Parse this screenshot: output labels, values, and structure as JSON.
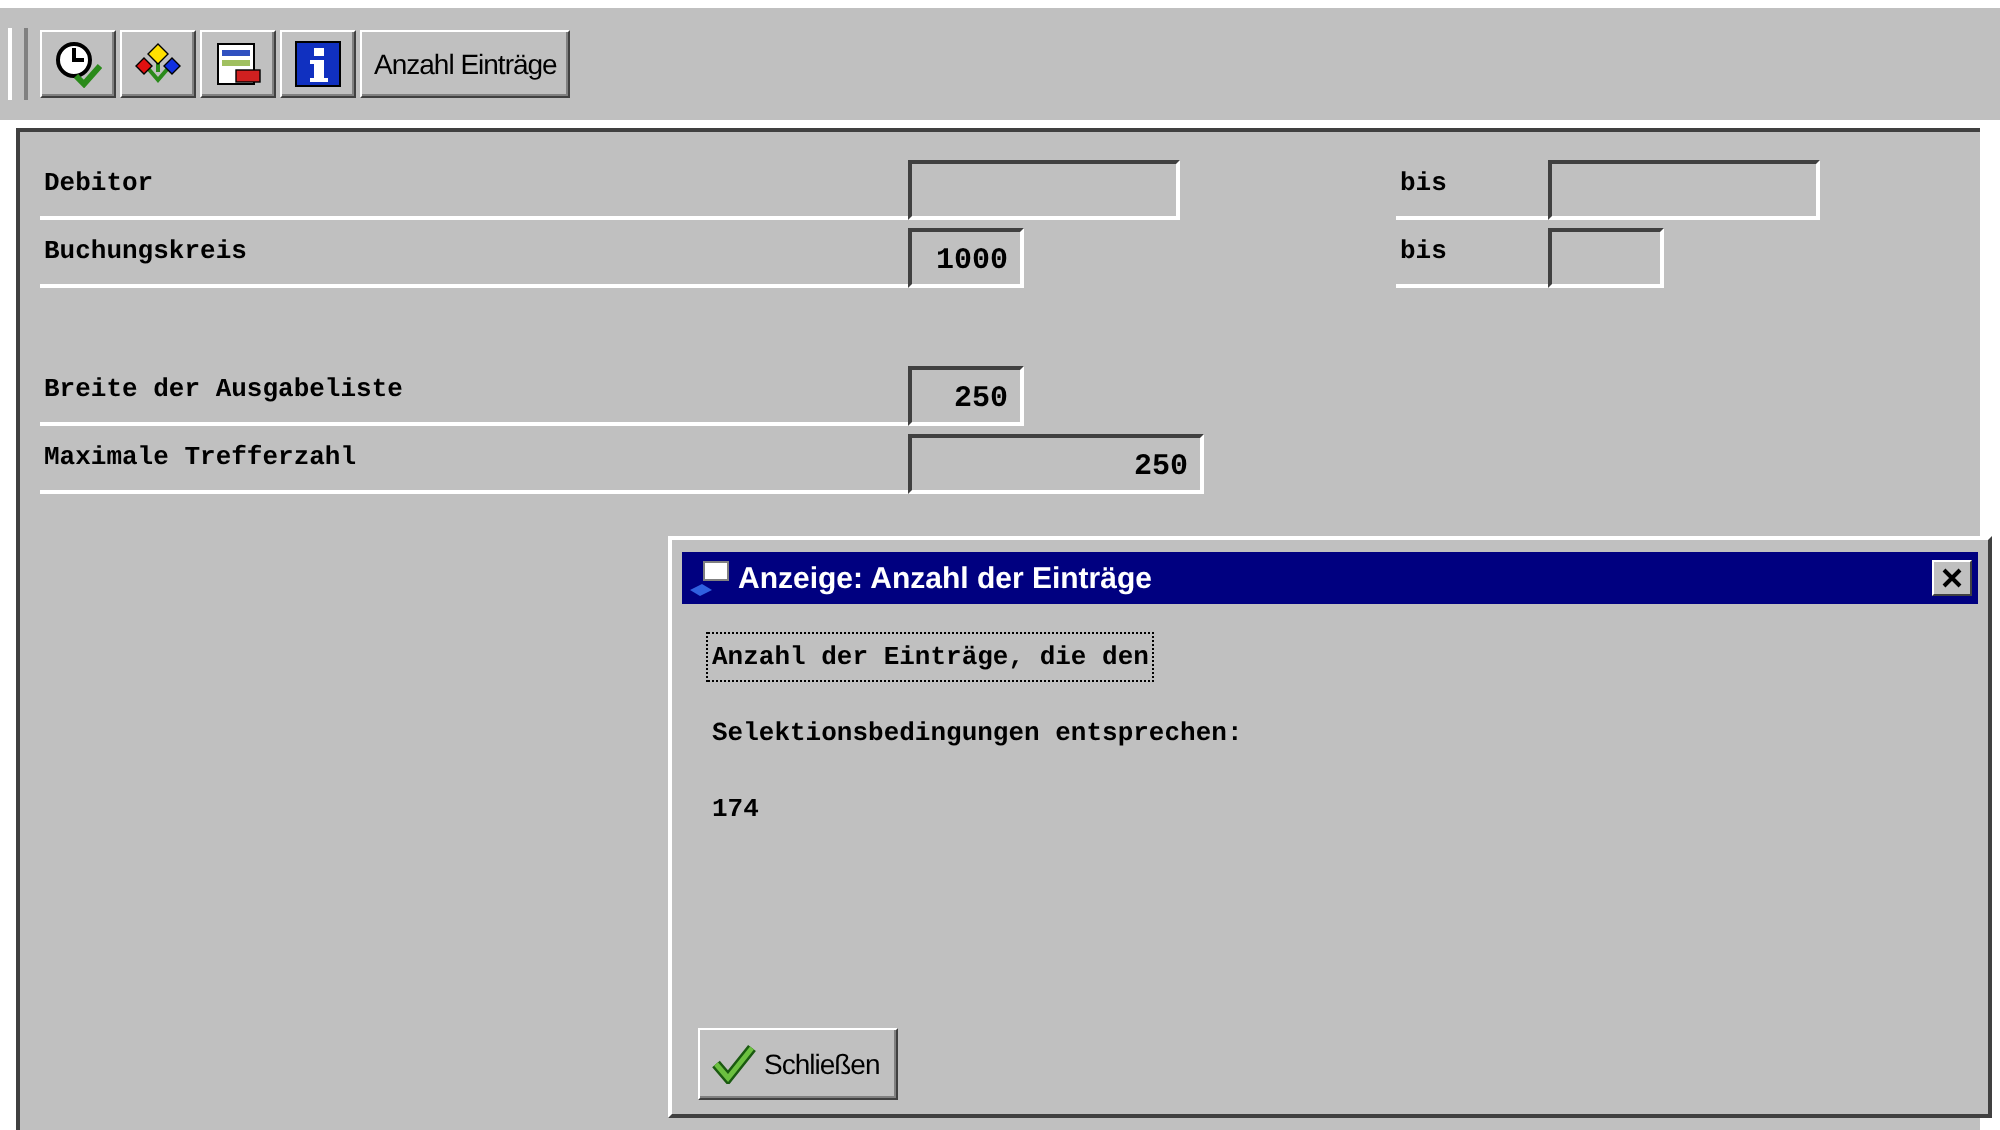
{
  "toolbar": {
    "button": "Anzahl Einträge"
  },
  "field_groups": [
    [
      {
        "label": "Debitor",
        "to_label": "bis"
      },
      {
        "label": "Buchungskreis",
        "value": "1000",
        "to_label": "bis"
      }
    ],
    [
      {
        "label": "Breite der Ausgabeliste",
        "value": "250"
      },
      {
        "label": "Maximale Trefferzahl",
        "value": "250"
      }
    ]
  ],
  "dialog": {
    "title": "Anzeige: Anzahl der Einträge",
    "lines": [
      {
        "text": "Anzahl der Einträge, die den",
        "focused": true
      },
      {
        "text": "Selektionsbedingungen entsprechen:",
        "focused": false
      },
      {
        "text": "174",
        "focused": false
      }
    ],
    "button": "Schließen"
  }
}
